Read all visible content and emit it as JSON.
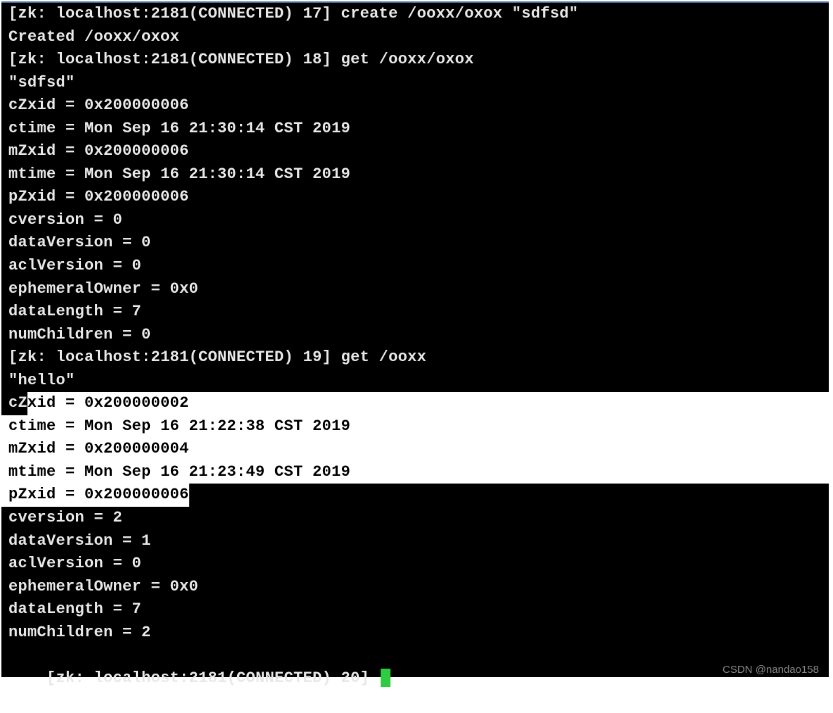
{
  "prompts": {
    "p17": "[zk: localhost:2181(CONNECTED) 17] create /ooxx/oxox \"sdfsd\"",
    "p18": "[zk: localhost:2181(CONNECTED) 18] get /ooxx/oxox",
    "p19": "[zk: localhost:2181(CONNECTED) 19] get /ooxx",
    "p20": "[zk: localhost:2181(CONNECTED) 20] "
  },
  "created": "Created /ooxx/oxox",
  "node1": {
    "data": "\"sdfsd\"",
    "cZxid": "cZxid = 0x200000006",
    "ctime": "ctime = Mon Sep 16 21:30:14 CST 2019",
    "mZxid": "mZxid = 0x200000006",
    "mtime": "mtime = Mon Sep 16 21:30:14 CST 2019",
    "pZxid": "pZxid = 0x200000006",
    "cversion": "cversion = 0",
    "dataVersion": "dataVersion = 0",
    "aclVersion": "aclVersion = 0",
    "ephemeralOwner": "ephemeralOwner = 0x0",
    "dataLength": "dataLength = 7",
    "numChildren": "numChildren = 0"
  },
  "node2": {
    "data": "\"hello\"",
    "cZxid_prefix": "cZ",
    "cZxid_rest": "xid = 0x200000002",
    "ctime": "ctime = Mon Sep 16 21:22:38 CST 2019",
    "mZxid": "mZxid = 0x200000004",
    "mtime": "mtime = Mon Sep 16 21:23:49 CST 2019",
    "pZxid": "pZxid = 0x200000006",
    "cversion": "cversion = 2",
    "dataVersion": "dataVersion = 1",
    "aclVersion": "aclVersion = 0",
    "ephemeralOwner": "ephemeralOwner = 0x0",
    "dataLength": "dataLength = 7",
    "numChildren": "numChildren = 2"
  },
  "watermark": "CSDN @nandao158"
}
